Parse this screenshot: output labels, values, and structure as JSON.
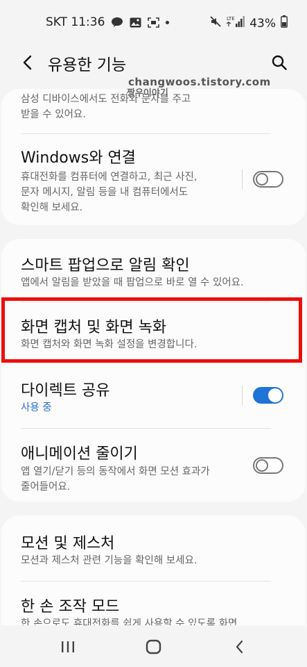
{
  "status_bar": {
    "carrier_time": "SKT 11:36",
    "network": "LTE",
    "battery": "43%"
  },
  "app_bar": {
    "title": "유용한 기능",
    "back_icon": "back-arrow-icon",
    "search_icon": "search-icon"
  },
  "watermark": {
    "url": "changwoos.tistory.com",
    "name": "짱우이야기"
  },
  "card1": {
    "prev_item_partial": {
      "desc_line1": "삼성 디바이스에서도 전화와 문자를 주고",
      "desc_line2": "받을 수 있어요."
    },
    "windows": {
      "title": "Windows와 연결",
      "desc_line1": "휴대전화를 컴퓨터에 연결하고, 최근 사진,",
      "desc_line2": "문자 메시지, 알림 등을 내 컴퓨터에서도",
      "desc_line3": "확인해 보세요.",
      "toggle_on": false
    }
  },
  "card2": {
    "smart_popup": {
      "title": "스마트 팝업으로 알림 확인",
      "desc": "앱에서 알림을 받았을 때 팝업으로 바로 열 수 있어요."
    },
    "screenshot": {
      "title": "화면 캡처 및 화면 녹화",
      "desc": "화면 캡처와 화면 녹화 설정을 변경합니다.",
      "highlighted": true
    },
    "direct_share": {
      "title": "다이렉트 공유",
      "desc": "사용 중",
      "toggle_on": true
    },
    "reduce_animation": {
      "title": "애니메이션 줄이기",
      "desc_line1": "앱 열기/닫기 등의 동작에서 화면 모션 효과가",
      "desc_line2": "줄어들어요.",
      "toggle_on": false
    }
  },
  "card3": {
    "motions": {
      "title": "모션 및 제스처",
      "desc": "모션과 제스처 관련 기능을 확인해 보세요."
    },
    "one_hand": {
      "title": "한 손 조작 모드",
      "desc_partial": "한 손으로도 휴대전화를 쉽게 사용할 수 있도록 화면"
    }
  },
  "nav_bar": {
    "recents_icon": "recent-apps-icon",
    "home_icon": "home-icon",
    "back_icon": "back-icon"
  },
  "colors": {
    "highlight_border": "#ee0d0d",
    "toggle_on": "#1f74d8",
    "accent_text": "#2770c8"
  }
}
